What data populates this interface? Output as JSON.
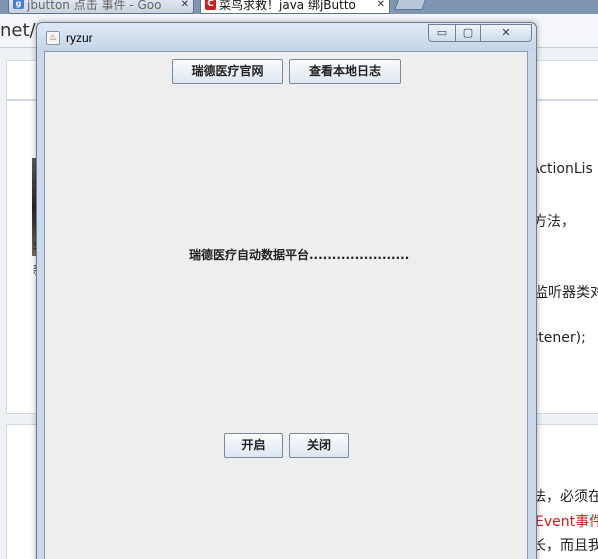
{
  "browser": {
    "tabs": [
      {
        "label": "jbutton 点击 事件 - Goo",
        "icon": "google-icon"
      },
      {
        "label": "菜鸟求救！java 绑jButto",
        "icon": "csdn-icon",
        "icon_letter": "C"
      }
    ],
    "tab_close_glyph": "✕",
    "icon_letter_g": "g",
    "url_fragment": "net/t",
    "side_texts": [
      "ActionLis",
      "方法，",
      "监听器类对",
      "stener);",
      "法，必须在",
      "Event事件",
      "长，而且我"
    ],
    "left_fragments": [
      "s",
      "s",
      "新"
    ]
  },
  "window": {
    "title": "ryzur",
    "icon": "java-cup-icon",
    "controls": {
      "minimize": "▭",
      "maximize": "▢",
      "close": "✕"
    },
    "buttons": {
      "official_site": "瑞德医疗官网",
      "view_log": "查看本地日志",
      "start": "开启",
      "close": "关闭"
    },
    "center_label": "瑞德医疗自动数据平台......................"
  }
}
